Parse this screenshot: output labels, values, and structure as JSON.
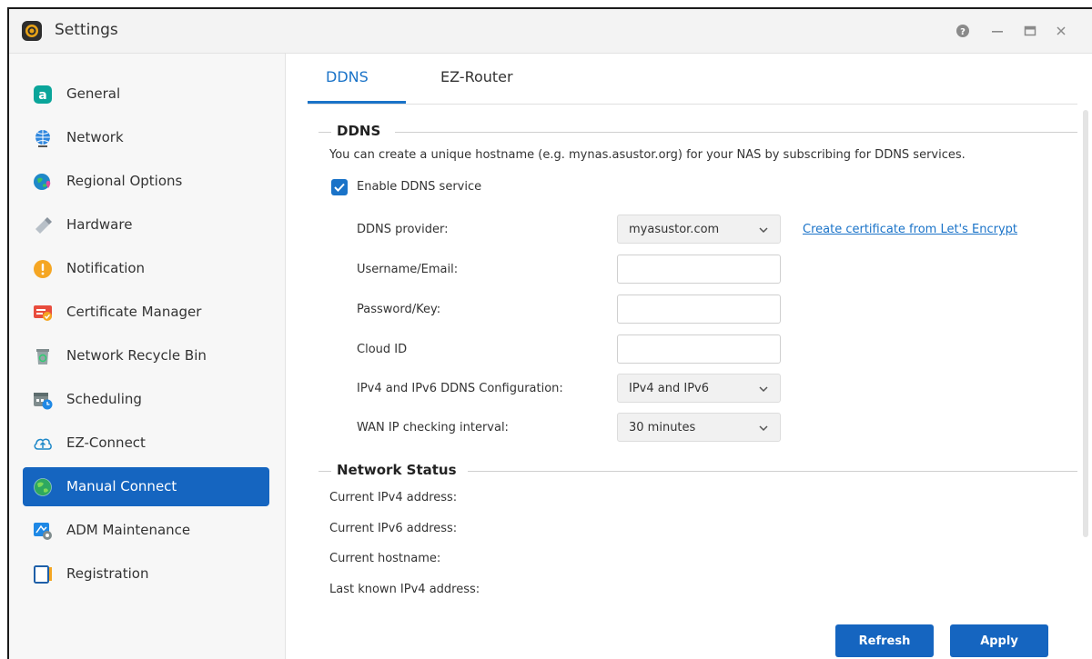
{
  "window": {
    "title": "Settings"
  },
  "sidebar": {
    "items": [
      {
        "label": "General",
        "icon": "general-icon"
      },
      {
        "label": "Network",
        "icon": "network-globe-icon"
      },
      {
        "label": "Regional Options",
        "icon": "regional-globe-icon"
      },
      {
        "label": "Hardware",
        "icon": "hardware-icon"
      },
      {
        "label": "Notification",
        "icon": "notification-icon"
      },
      {
        "label": "Certificate Manager",
        "icon": "certificate-icon"
      },
      {
        "label": "Network Recycle Bin",
        "icon": "recycle-bin-icon"
      },
      {
        "label": "Scheduling",
        "icon": "calendar-clock-icon"
      },
      {
        "label": "EZ-Connect",
        "icon": "cloud-upload-icon"
      },
      {
        "label": "Manual Connect",
        "icon": "manual-connect-globe-icon",
        "active": true
      },
      {
        "label": "ADM Maintenance",
        "icon": "maintenance-icon"
      },
      {
        "label": "Registration",
        "icon": "registration-icon"
      }
    ]
  },
  "tabs": [
    {
      "label": "DDNS",
      "active": true
    },
    {
      "label": "EZ-Router",
      "active": false
    }
  ],
  "ddns": {
    "section_title": "DDNS",
    "description": "You can create a unique hostname (e.g. mynas.asustor.org) for your NAS by subscribing for DDNS services.",
    "enable_label": "Enable DDNS service",
    "enabled": true,
    "provider_label": "DDNS provider:",
    "provider_value": "myasustor.com",
    "certificate_link": "Create certificate from Let's Encrypt",
    "username_label": "Username/Email:",
    "username_value": "",
    "password_label": "Password/Key:",
    "password_value": "",
    "cloud_id_label": "Cloud ID",
    "cloud_id_value": "",
    "ip_config_label": "IPv4 and IPv6 DDNS Configuration:",
    "ip_config_value": "IPv4 and IPv6",
    "wan_interval_label": "WAN IP checking interval:",
    "wan_interval_value": "30 minutes"
  },
  "network_status": {
    "section_title": "Network Status",
    "ipv4_label": "Current IPv4 address:",
    "ipv6_label": "Current IPv6 address:",
    "hostname_label": "Current hostname:",
    "last_ipv4_label": "Last known IPv4 address:"
  },
  "buttons": {
    "refresh": "Refresh",
    "apply": "Apply"
  },
  "colors": {
    "accent": "#1a73c8",
    "active_item": "#1565c0",
    "button": "#1565c0"
  }
}
